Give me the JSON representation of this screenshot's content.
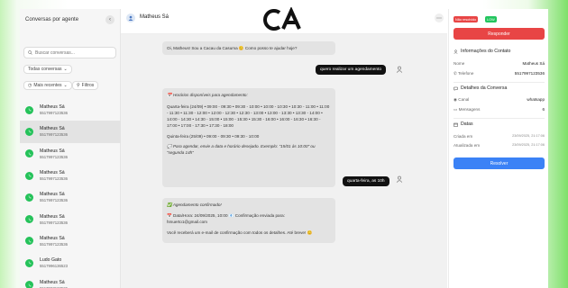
{
  "sidebar": {
    "title": "Conversas por agente",
    "collapse_icon": "chevron-left-icon",
    "search_placeholder": "Buscar conversas...",
    "filter_all": "Todas conversas",
    "sort": "Mais recentes",
    "filters_label": "Filtros",
    "conversations": [
      {
        "name": "Matheus Sá",
        "phone": "5517997123536",
        "active": false
      },
      {
        "name": "Matheus Sá",
        "phone": "5517997123536",
        "active": true
      },
      {
        "name": "Matheus Sá",
        "phone": "5517997123536",
        "active": false
      },
      {
        "name": "Matheus Sá",
        "phone": "5517997123536",
        "active": false
      },
      {
        "name": "Matheus Sá",
        "phone": "5517997123536",
        "active": false
      },
      {
        "name": "Matheus Sá",
        "phone": "5517997123536",
        "active": false
      },
      {
        "name": "Matheus Sá",
        "phone": "5517997123536",
        "active": false
      },
      {
        "name": "Ludo Gato",
        "phone": "5517996136523",
        "active": false
      },
      {
        "name": "Matheus Sá",
        "phone": "5517997123536",
        "active": false
      }
    ]
  },
  "header": {
    "contact_name": "Matheus Sá",
    "logo_text": "CA",
    "more_icon": "more-dots-icon"
  },
  "chat": {
    "greeting": "Oi, Matheus! Sou a Cacau da Casuma 😊 Como posso te ajudar hoje?",
    "user_msg_1": "quero realizar um agendamento",
    "schedule_title": "📅 Horários disponíveis para agendamento:",
    "schedule_day1": "Quarta-feira (24/09) • 09:00 - 09:30 • 09:30 - 10:00 • 10:00 - 10:30 • 10:30 - 11:00 • 11:00 - 11:30 • 11:30 - 12:00 • 12:00 - 12:30 • 12:30 - 13:00 • 13:00 - 13:30 • 13:30 - 14:00 • 14:00 - 14:30 • 14:30 - 15:00 • 15:00 - 15:30 • 15:30 - 16:00 • 16:00 - 16:30 • 16:30 - 17:00 • 17:00 - 17:30 • 17:30 - 18:00",
    "schedule_day2": "Quinta-feira (25/09) • 09:00 - 09:30 • 09:30 - 10:00",
    "schedule_hint": "💬 Para agendar, envie a data e horário desejado. Exemplo: \"15/01 às 10:00\" ou \"segunda 14h\"",
    "user_msg_2": "quarta-feira, as 10h",
    "confirm_title": "✅ Agendamento confirmado!",
    "confirm_line_prefix": "📅 Data/Hora: 24/09/2025, 10:00 📧 Confirmação enviada para:",
    "confirm_email": "hmuerto1@gmail.com",
    "confirm_footer": "Você receberá um e-mail de confirmação com todos os detalhes. Até breve! 😊"
  },
  "panel": {
    "badge_status": "Não resolvido",
    "badge_priority": "LOW",
    "status_color": "#e84545",
    "priority_color": "#22c55e",
    "respond_button": "Responder",
    "contact_section": "Informações do Contato",
    "name_label": "Nome",
    "name_value": "Matheus Sá",
    "phone_label": "Telefone",
    "phone_value": "5517997123536",
    "details_section": "Detalhes da Conversa",
    "channel_label": "Canal",
    "channel_value": "whatsapp",
    "messages_label": "Mensagens",
    "messages_value": "6",
    "dates_section": "Datas",
    "created_label": "Criada em",
    "created_value": "23/09/2025, 21:17:06",
    "updated_label": "Atualizada em",
    "updated_value": "23/09/2025, 21:17:06",
    "resolve_button": "Resolver"
  }
}
